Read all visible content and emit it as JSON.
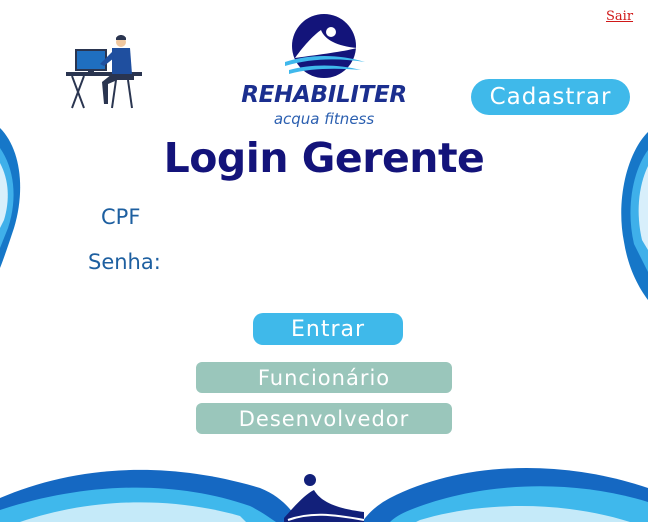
{
  "header": {
    "logout_label": "Sair",
    "register_button_label": "Cadastrar"
  },
  "brand": {
    "name": "REHABILITER",
    "tagline": "acqua fitness"
  },
  "page_title": "Login Gerente",
  "form": {
    "cpf_label": "CPF",
    "cpf_value": "",
    "password_label": "Senha:",
    "password_value": ""
  },
  "buttons": {
    "login_label": "Entrar",
    "employee_label": "Funcionário",
    "developer_label": "Desenvolvedor"
  },
  "colors": {
    "primary_blue": "#3fb9ea",
    "title_navy": "#13137a",
    "label_blue": "#1d5fa0",
    "muted_green": "#9ac6bb",
    "logout_red": "#d01818"
  },
  "icons": [
    "office-worker-illustration",
    "swimmer-logo-icon",
    "wave-decoration",
    "swimmer-icon"
  ]
}
